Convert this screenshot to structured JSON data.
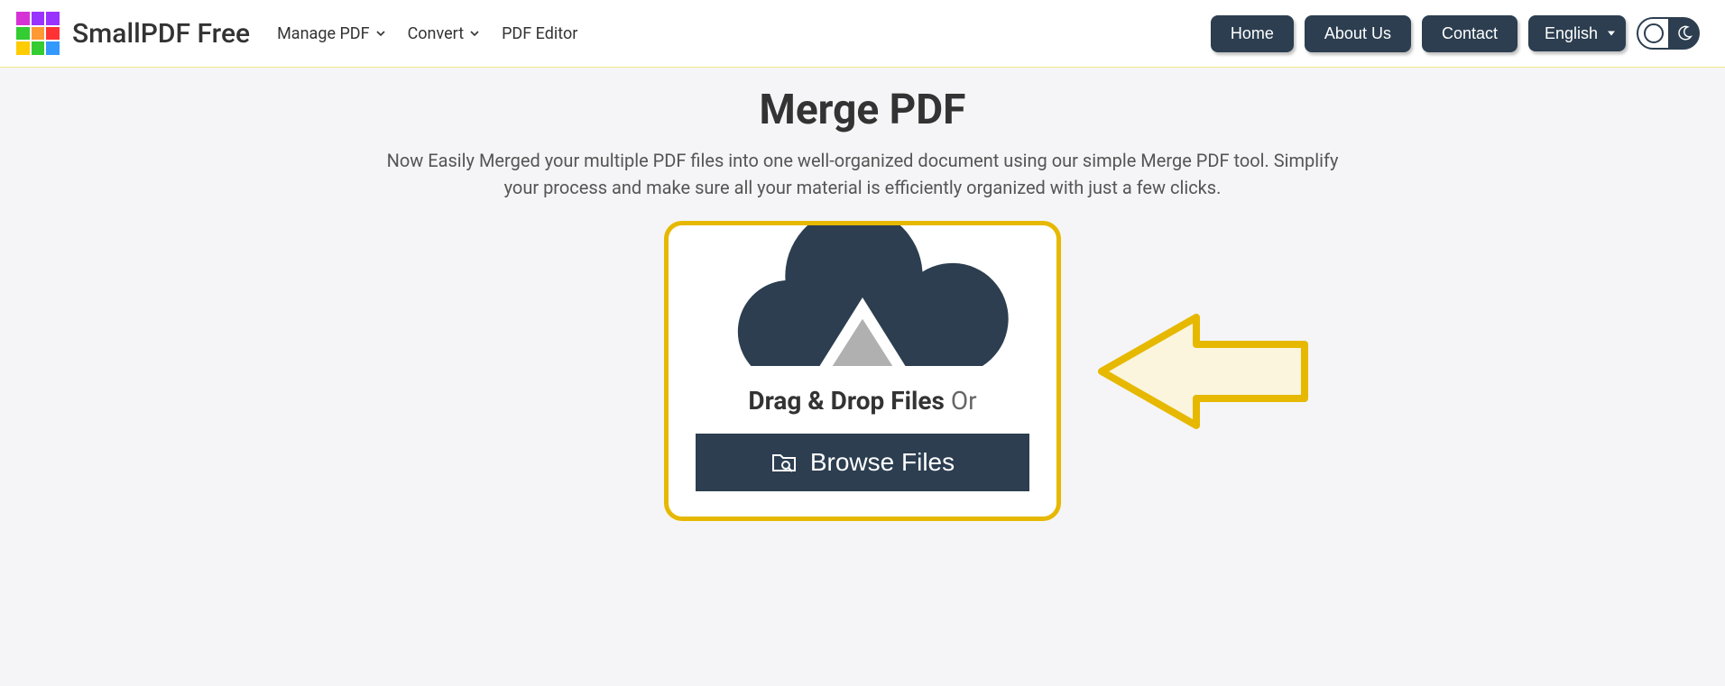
{
  "brand": {
    "name": "SmallPDF Free"
  },
  "nav": {
    "manage": "Manage PDF",
    "convert": "Convert",
    "editor": "PDF Editor"
  },
  "buttons": {
    "home": "Home",
    "about": "About Us",
    "contact": "Contact"
  },
  "lang": {
    "selected": "English"
  },
  "page": {
    "title": "Merge PDF",
    "subtitle": "Now Easily Merged your multiple PDF files into one well-organized document using our simple Merge PDF tool. Simplify your process and make sure all your material is efficiently organized with just a few clicks."
  },
  "drop": {
    "drag_bold": "Drag & Drop Files",
    "drag_or": " Or",
    "browse": "Browse Files"
  },
  "logo_colors": [
    "#d633d6",
    "#9933ff",
    "#9933ff",
    "#33cc33",
    "#ff9933",
    "#ff3333",
    "#ffcc00",
    "#33cc33",
    "#3399ff"
  ]
}
